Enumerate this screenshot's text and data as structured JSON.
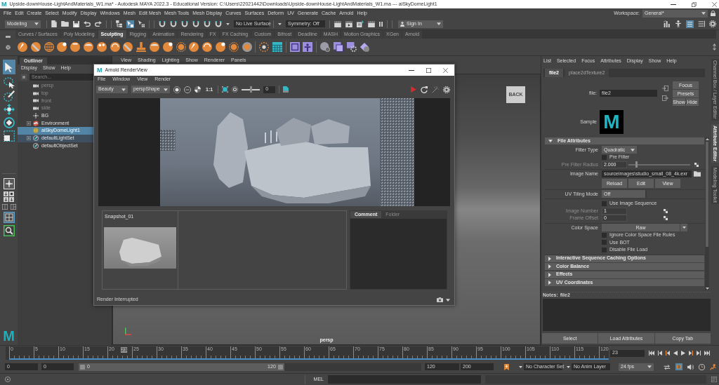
{
  "window": {
    "logo": "M",
    "title": "Upside-downHouse-LightAndMaterials_W1.ma* - Autodesk MAYA 2022.3 - Educational Version: C:\\Users\\22021442\\Downloads\\Upside-downHouse-LightAndMaterials_W1.ma  ---  aiSkyDomeLight1"
  },
  "menu_bar": {
    "items": [
      "File",
      "Edit",
      "Create",
      "Select",
      "Modify",
      "Display",
      "Windows",
      "Mesh",
      "Edit Mesh",
      "Mesh Tools",
      "Mesh Display",
      "Curves",
      "Surfaces",
      "Deform",
      "UV",
      "Generate",
      "Cache",
      "Arnold",
      "Help"
    ],
    "workspace_label": "Workspace:",
    "workspace": "General*"
  },
  "status_line": {
    "menu_set": "Modeling",
    "live_surface": "No Live Surface",
    "symmetry": "Symmetry: Off",
    "sign_in": "Sign In"
  },
  "shelf": {
    "tabs": [
      {
        "label": "Curves / Surfaces",
        "selected": false
      },
      {
        "label": "Poly Modeling",
        "selected": false
      },
      {
        "label": "Sculpting",
        "selected": true
      },
      {
        "label": "Rigging",
        "selected": false
      },
      {
        "label": "Animation",
        "selected": false
      },
      {
        "label": "Rendering",
        "selected": false
      },
      {
        "label": "FX",
        "selected": false
      },
      {
        "label": "FX Caching",
        "selected": false
      },
      {
        "label": "Custom",
        "selected": false
      },
      {
        "label": "Bifrost",
        "selected": false
      },
      {
        "label": "Deadline",
        "selected": false
      },
      {
        "label": "MASH",
        "selected": false
      },
      {
        "label": "Motion Graphics",
        "selected": false
      },
      {
        "label": "XGen",
        "selected": false
      },
      {
        "label": "Arnold",
        "selected": false
      }
    ]
  },
  "toolbox": {
    "logo": "M"
  },
  "outliner": {
    "tab": "Outliner",
    "menu": [
      "Display",
      "Show",
      "Help"
    ],
    "search_placeholder": "Search...",
    "items": [
      {
        "label": "persp",
        "kind": "camera",
        "expandable": false,
        "selected": false,
        "highlighted": false,
        "dimmed": true
      },
      {
        "label": "top",
        "kind": "camera",
        "expandable": false,
        "selected": false,
        "highlighted": false,
        "dimmed": true
      },
      {
        "label": "front",
        "kind": "camera",
        "expandable": false,
        "selected": false,
        "highlighted": false,
        "dimmed": true
      },
      {
        "label": "side",
        "kind": "camera",
        "expandable": false,
        "selected": false,
        "highlighted": false,
        "dimmed": true
      },
      {
        "label": "BG",
        "kind": "transform",
        "expandable": false,
        "selected": false,
        "highlighted": false,
        "dimmed": false
      },
      {
        "label": "Environment",
        "kind": "group",
        "expandable": true,
        "selected": false,
        "highlighted": false,
        "dimmed": false
      },
      {
        "label": "aiSkyDomeLight1",
        "kind": "light",
        "expandable": false,
        "selected": true,
        "highlighted": false,
        "dimmed": false
      },
      {
        "label": "defaultLightSet",
        "kind": "set",
        "expandable": true,
        "selected": false,
        "highlighted": true,
        "dimmed": false
      },
      {
        "label": "defaultObjectSet",
        "kind": "set",
        "expandable": false,
        "selected": false,
        "highlighted": false,
        "dimmed": false
      }
    ]
  },
  "viewport": {
    "menu": [
      "View",
      "Shading",
      "Lighting",
      "Show",
      "Renderer",
      "Panels"
    ],
    "view_cube": "BACK",
    "camera": "persp"
  },
  "render_view": {
    "logo": "M",
    "title": "Arnold RenderView",
    "menu": [
      "File",
      "Window",
      "View",
      "Render"
    ],
    "aov": "Beauty",
    "camera": "perspShape",
    "zoom": "1:1",
    "exposure_slider": {
      "level": 0.5
    },
    "exposure": "0",
    "snapshot": "Snapshot_01",
    "tabs": [
      {
        "label": "Comment",
        "selected": true
      },
      {
        "label": "Folder",
        "selected": false
      }
    ],
    "status": "Render Interrupted"
  },
  "attribute_editor": {
    "menu": [
      "List",
      "Selected",
      "Focus",
      "Attributes",
      "Display",
      "Show",
      "Help"
    ],
    "tabs": [
      {
        "label": "file2",
        "selected": true
      },
      {
        "label": "place2dTexture2",
        "selected": false
      }
    ],
    "node_label": "file:",
    "node_name": "file2",
    "buttons": [
      "Focus",
      "Presets",
      "Show",
      "Hide"
    ],
    "sample_label": "Sample",
    "sample_swatch": "M",
    "sections": [
      {
        "title": "File Attributes",
        "expanded": true,
        "groups": [
          [
            {
              "kind": "dropdown",
              "label": "Filter Type",
              "value": "Quadratic",
              "disabled": false
            },
            {
              "kind": "checkbox",
              "label": "Pre Filter",
              "checked": false,
              "disabled": false
            },
            {
              "kind": "slider",
              "label": "Pre Filter Radius",
              "value": "2.000",
              "level": 0.12,
              "disabled": true
            }
          ],
          [
            {
              "kind": "file",
              "label": "Image Name",
              "value": "sourceimages\\studio_small_08_4k.exr",
              "disabled": false
            },
            {
              "kind": "buttons",
              "items": [
                "Reload",
                "Edit",
                "View"
              ],
              "disabled": false
            }
          ],
          [
            {
              "kind": "option",
              "label": "UV Tiling Mode",
              "value": "Off",
              "disabled": false
            }
          ],
          [
            {
              "kind": "checkbox",
              "label": "Use Image Sequence",
              "checked": false,
              "disabled": false
            },
            {
              "kind": "field",
              "label": "Image Number",
              "value": "1",
              "disabled": true
            },
            {
              "kind": "field",
              "label": "Frame Offset",
              "value": "0",
              "disabled": true
            }
          ],
          [
            {
              "kind": "wide_dropdown",
              "label": "Color Space",
              "value": "Raw",
              "disabled": false
            },
            {
              "kind": "checkbox",
              "label": "Ignore Color Space File Rules",
              "checked": false,
              "disabled": false
            },
            {
              "kind": "checkbox",
              "label": "Use BOT",
              "checked": false,
              "disabled": false
            },
            {
              "kind": "checkbox",
              "label": "Disable File Load",
              "checked": false,
              "disabled": false
            }
          ]
        ]
      },
      {
        "title": "Interactive Sequence Caching Options",
        "expanded": false
      },
      {
        "title": "Color Balance",
        "expanded": false
      },
      {
        "title": "Effects",
        "expanded": false
      },
      {
        "title": "UV Coordinates",
        "expanded": false
      }
    ],
    "notes_label": "Notes:",
    "notes_node": "file2",
    "footer_buttons": [
      "Select",
      "Load Attributes",
      "Copy Tab"
    ]
  },
  "side_tabs": [
    {
      "label": "Channel Box / Layer Editor",
      "selected": false
    },
    {
      "label": "Attribute Editor",
      "selected": true
    },
    {
      "label": "Modeling Toolkit",
      "selected": false
    }
  ],
  "time_slider": {
    "ticks": [
      "0",
      "5",
      "10",
      "15",
      "20",
      "25",
      "30",
      "35",
      "40",
      "45",
      "50",
      "55",
      "60",
      "65",
      "70",
      "75",
      "80",
      "85",
      "90",
      "95",
      "100",
      "105",
      "110",
      "115",
      "120"
    ],
    "playhead": {
      "label": "23",
      "level": 0.1917
    },
    "current_frame": "23"
  },
  "range_slider": {
    "start": "0",
    "playback_start": "0",
    "bar": {
      "start": "0",
      "end": "120",
      "level": 0.6
    },
    "playback_end": "120",
    "end": "200",
    "character_set": "No Character Set",
    "anim_layer": "No Anim Layer",
    "fps": "24 fps"
  },
  "command_line": {
    "language": "MEL"
  }
}
